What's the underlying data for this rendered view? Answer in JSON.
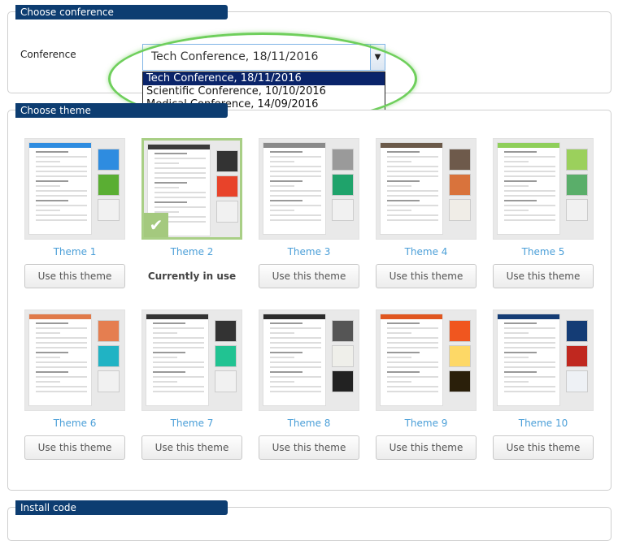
{
  "sections": {
    "choose_conference": "Choose conference",
    "choose_theme": "Choose theme",
    "install_code": "Install code"
  },
  "conference": {
    "label": "Conference",
    "selected": "Tech Conference, 18/11/2016",
    "options": [
      "Tech Conference, 18/11/2016",
      "Scientific Conference, 10/10/2016",
      "Medical Conference, 14/09/2016"
    ]
  },
  "use_button_label": "Use this theme",
  "current_label": "Currently in use",
  "themes": [
    {
      "name": "Theme 1",
      "header": "#2e8ce0",
      "swatches": [
        "#2e8ce0",
        "#5aae33",
        "#f1f1f1"
      ],
      "current": false
    },
    {
      "name": "Theme 2",
      "header": "#3a3a3a",
      "swatches": [
        "#333333",
        "#e8432a",
        "#f1f1f1"
      ],
      "current": true
    },
    {
      "name": "Theme 3",
      "header": "#8a8a8a",
      "swatches": [
        "#9a9a9a",
        "#1fa36b",
        "#f1f1f1"
      ],
      "current": false
    },
    {
      "name": "Theme 4",
      "header": "#6b5a4a",
      "swatches": [
        "#6e5a4b",
        "#d9733c",
        "#f0ede7"
      ],
      "current": false
    },
    {
      "name": "Theme 5",
      "header": "#8fcf5a",
      "swatches": [
        "#9bd05c",
        "#5aae6a",
        "#f1f1f1"
      ],
      "current": false
    },
    {
      "name": "Theme 6",
      "header": "#e07a4a",
      "swatches": [
        "#e57e50",
        "#20b3c4",
        "#f1f1f1"
      ],
      "current": false
    },
    {
      "name": "Theme 7",
      "header": "#333333",
      "swatches": [
        "#333333",
        "#21c392",
        "#f1f1f1"
      ],
      "current": false
    },
    {
      "name": "Theme 8",
      "header": "#2b2b2b",
      "swatches": [
        "#555555",
        "#efefea",
        "#222222"
      ],
      "current": false
    },
    {
      "name": "Theme 9",
      "header": "#e0561f",
      "swatches": [
        "#f0561f",
        "#fdd866",
        "#2a1f0a"
      ],
      "current": false
    },
    {
      "name": "Theme 10",
      "header": "#143c75",
      "swatches": [
        "#143c75",
        "#c0281f",
        "#eef1f5"
      ],
      "current": false
    }
  ]
}
